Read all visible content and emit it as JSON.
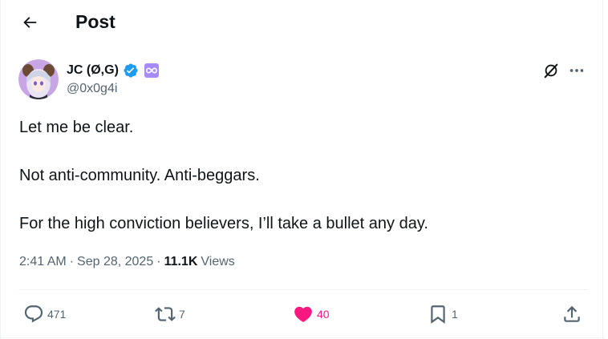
{
  "header": {
    "title": "Post",
    "back_icon": "arrow-left-icon"
  },
  "author": {
    "display_name": "JC (Ø,G)",
    "handle": "@0x0g4i",
    "verified": true,
    "verified_color": "#1d9bf0",
    "affiliate_badge_color": "#a78bfa"
  },
  "post": {
    "lines": [
      "Let me be clear.",
      "Not anti-community. Anti-beggars.",
      "For the high conviction believers, I’ll take a bullet any day."
    ],
    "time": "2:41 AM",
    "date": "Sep 28, 2025",
    "views_count": "11.1K",
    "views_label": "Views"
  },
  "actions": {
    "replies": "471",
    "reposts": "7",
    "likes": "40",
    "bookmarks": "1",
    "like_color": "#f91880"
  },
  "colors": {
    "text_primary": "#0f1419",
    "text_secondary": "#536471",
    "divider": "#eff3f4"
  }
}
